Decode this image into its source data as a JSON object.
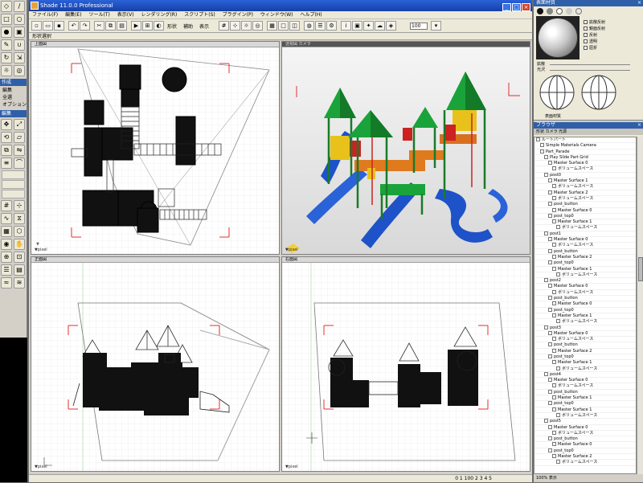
{
  "window": {
    "title": "Shade 11.0.0 Professional",
    "buttons": [
      "_",
      "□",
      "×"
    ]
  },
  "menubar": [
    "ファイル(F)",
    "編集(E)",
    "ツール(T)",
    "表示(V)",
    "レンダリング(R)",
    "スクリプト(S)",
    "プラグイン(P)",
    "ウィンドウ(W)",
    "ヘルプ(H)"
  ],
  "toolbar": {
    "label_a": "形状",
    "label_b": "補助",
    "label_c": "表示",
    "zoom_value": "100"
  },
  "subbar": {
    "label": "形状選択"
  },
  "views": {
    "top": {
      "header": "上面図",
      "footer": "▼pixel"
    },
    "perspective": {
      "header": "透視図  カメラ",
      "footer": "▼pixel"
    },
    "front": {
      "header": "正面図",
      "footer": "▼pixel"
    },
    "side": {
      "header": "右面図",
      "footer": "▼pixel"
    }
  },
  "statusbar": {
    "left": "",
    "right": "0    1    100    2    3    4    5"
  },
  "left_palette": {
    "group1": "作成",
    "group2": "編集",
    "labels": [
      "編集",
      "全選",
      "オプション"
    ]
  },
  "material_panel": {
    "title": "表面材質",
    "props": [
      "拡散反射",
      "鏡面反射",
      "反射",
      "透明",
      "屈折"
    ],
    "slider1": "拡散",
    "slider2": "光沢",
    "footer_check": "表面材質"
  },
  "browser_panel": {
    "title": "ブラウザ",
    "tabs": "形状  カメラ  光源",
    "items": [
      "ルートパート",
      "Simple Materials Camera",
      "Part_Parade",
      "Play Slide Part Grid",
      "Master Surface 0",
      "ボリュームスペース",
      "post0",
      "Master Surface 1",
      "ボリュームスペース",
      "Master Surface 2",
      "ボリュームスペース",
      "post_button",
      "Master Surface 0",
      "post_top0",
      "Master Surface 1",
      "ボリュームスペース",
      "post1",
      "Master Surface 0",
      "ボリュームスペース",
      "post_button",
      "Master Surface 2",
      "post_top0",
      "Master Surface 1",
      "ボリュームスペース",
      "post2",
      "Master Surface 0",
      "ボリュームスペース",
      "post_button",
      "Master Surface 0",
      "post_top0",
      "Master Surface 1",
      "ボリュームスペース",
      "post3",
      "Master Surface 0",
      "ボリュームスペース",
      "post_button",
      "Master Surface 2",
      "post_top0",
      "Master Surface 1",
      "ボリュームスペース",
      "post4",
      "Master Surface 0",
      "ボリュームスペース",
      "post_button",
      "Master Surface 1",
      "post_top0",
      "Master Surface 1",
      "ボリュームスペース",
      "post5",
      "Master Surface 0",
      "ボリュームスペース",
      "post_button",
      "Master Surface 0",
      "post_top0",
      "Master Surface 2",
      "ボリュームスペース"
    ],
    "footer": "100% 表示"
  },
  "colors": {
    "titlebar": "#2b62d8",
    "roof_green": "#1aa33a",
    "slide_blue": "#1e52c8",
    "platform_orange": "#e07a1e",
    "wall_yellow": "#e8c21a",
    "wall_red": "#cc2222"
  }
}
